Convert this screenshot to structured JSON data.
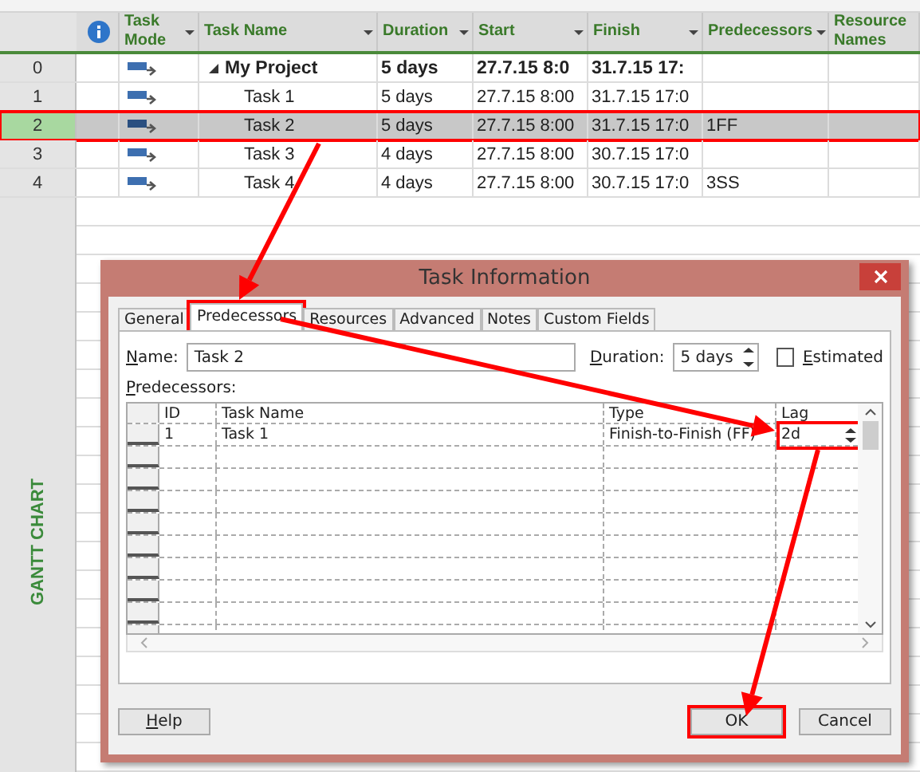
{
  "table": {
    "columns": [
      {
        "kind": "info"
      },
      {
        "kind": "text",
        "label": "Task Mode",
        "dropdown": true
      },
      {
        "kind": "text",
        "label": "Task Name",
        "dropdown": true
      },
      {
        "kind": "text",
        "label": "Duration",
        "dropdown": true
      },
      {
        "kind": "text",
        "label": "Start",
        "dropdown": true
      },
      {
        "kind": "text",
        "label": "Finish",
        "dropdown": true
      },
      {
        "kind": "text",
        "label": "Predecessors",
        "dropdown": true
      },
      {
        "kind": "text",
        "label": "Resource Names",
        "dropdown": false
      }
    ],
    "rows": [
      {
        "id": "0",
        "kind": "summary",
        "name": "My Project",
        "duration": "5 days",
        "start": "27.7.15 8:0",
        "finish": "31.7.15 17:",
        "selected": false,
        "highlighted": false
      },
      {
        "id": "1",
        "kind": "task",
        "name": "Task 1",
        "duration": "5 days",
        "start": "27.7.15 8:00",
        "finish": "31.7.15 17:0",
        "selected": false,
        "highlighted": false
      },
      {
        "id": "2",
        "kind": "task",
        "name": "Task 2",
        "duration": "5 days",
        "start": "27.7.15 8:00",
        "finish": "31.7.15 17:0",
        "predecessors": "1FF",
        "selected": true,
        "highlighted": true
      },
      {
        "id": "3",
        "kind": "task",
        "name": "Task 3",
        "duration": "4 days",
        "start": "27.7.15 8:00",
        "finish": "30.7.15 17:0",
        "selected": false,
        "highlighted": false
      },
      {
        "id": "4",
        "kind": "task",
        "name": "Task 4",
        "duration": "4 days",
        "start": "27.7.15 8:00",
        "finish": "30.7.15 17:0",
        "predecessors": "3SS",
        "selected": false,
        "highlighted": false
      }
    ]
  },
  "side_label": "GANTT CHART",
  "dialog": {
    "title": "Task Information",
    "tabs": [
      {
        "label": "General",
        "selected": false,
        "highlighted": false
      },
      {
        "label": "Predecessors",
        "selected": true,
        "highlighted": true
      },
      {
        "label": "Resources",
        "selected": false,
        "highlighted": false
      },
      {
        "label": "Advanced",
        "selected": false,
        "highlighted": false
      },
      {
        "label": "Notes",
        "selected": false,
        "highlighted": false
      },
      {
        "label": "Custom Fields",
        "selected": false,
        "highlighted": false
      }
    ],
    "name_label": "Name:",
    "name_value": "Task 2",
    "duration_label": "Duration:",
    "duration_value": "5 days",
    "estimated": {
      "label": "Estimated",
      "checked": false
    },
    "predecessors_label": "Predecessors:",
    "grid": {
      "columns": [
        "ID",
        "Task Name",
        "Type",
        "Lag"
      ],
      "rows": [
        {
          "id": "1",
          "task_name": "Task 1",
          "type": "Finish-to-Finish (FF)",
          "lag": {
            "value": "2d",
            "highlighted": true
          }
        }
      ]
    },
    "buttons": [
      {
        "kind": "help",
        "label": "Help",
        "highlighted": false
      },
      {
        "kind": "ok",
        "label": "OK",
        "highlighted": true
      },
      {
        "kind": "cancel",
        "label": "Cancel",
        "highlighted": false
      }
    ]
  }
}
